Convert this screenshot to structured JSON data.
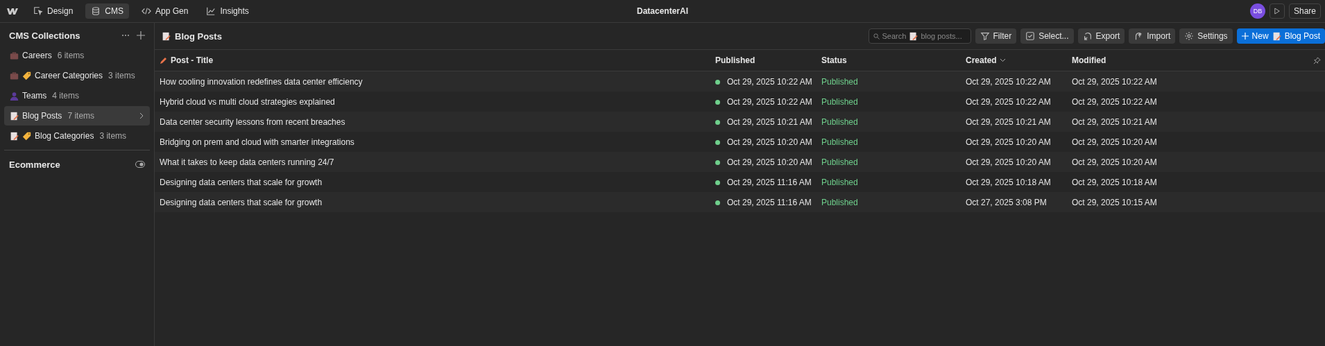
{
  "topbar": {
    "tabs": [
      {
        "label": "Design",
        "selected": false
      },
      {
        "label": "CMS",
        "selected": true
      },
      {
        "label": "App Gen",
        "selected": false
      },
      {
        "label": "Insights",
        "selected": false
      }
    ],
    "title": "DatacenterAI",
    "avatar": "DB",
    "share": "Share"
  },
  "sidebar": {
    "title": "CMS Collections",
    "items": [
      {
        "name": "Careers",
        "count": "6 items",
        "selected": false
      },
      {
        "name": "Career Categories",
        "count": "3 items",
        "selected": false
      },
      {
        "name": "Teams",
        "count": "4 items",
        "selected": false
      },
      {
        "name": "Blog Posts",
        "count": "7 items",
        "selected": true
      },
      {
        "name": "Blog Categories",
        "count": "3 items",
        "selected": false
      }
    ],
    "section": "Ecommerce"
  },
  "collection": {
    "title": "Blog Posts",
    "search": {
      "placeholder_before": "Search",
      "placeholder_after": "blog posts..."
    },
    "buttons": [
      {
        "label": "Filter"
      },
      {
        "label": "Select..."
      },
      {
        "label": "Export"
      },
      {
        "label": "Import"
      },
      {
        "label": "Settings"
      }
    ],
    "new_button": {
      "before": "New",
      "after": "Blog Post"
    }
  },
  "table": {
    "columns": [
      {
        "label": "Post - Title",
        "sorted": false
      },
      {
        "label": "Published",
        "sorted": false
      },
      {
        "label": "Status",
        "sorted": false
      },
      {
        "label": "Created",
        "sorted": true
      },
      {
        "label": "Modified",
        "sorted": false
      }
    ],
    "rows": [
      [
        "How cooling innovation redefines data center efficiency",
        "Oct 29, 2025 10:22 AM",
        "Published",
        "Oct 29, 2025 10:22 AM",
        "Oct 29, 2025 10:22 AM"
      ],
      [
        "Hybrid cloud vs multi cloud strategies explained",
        "Oct 29, 2025 10:22 AM",
        "Published",
        "Oct 29, 2025 10:22 AM",
        "Oct 29, 2025 10:22 AM"
      ],
      [
        "Data center security lessons from recent breaches",
        "Oct 29, 2025 10:21 AM",
        "Published",
        "Oct 29, 2025 10:21 AM",
        "Oct 29, 2025 10:21 AM"
      ],
      [
        "Bridging on prem and cloud with smarter integrations",
        "Oct 29, 2025 10:20 AM",
        "Published",
        "Oct 29, 2025 10:20 AM",
        "Oct 29, 2025 10:20 AM"
      ],
      [
        "What it takes to keep data centers running 24/7",
        "Oct 29, 2025 10:20 AM",
        "Published",
        "Oct 29, 2025 10:20 AM",
        "Oct 29, 2025 10:20 AM"
      ],
      [
        "Designing data centers that scale for growth",
        "Oct 29, 2025 11:16 AM",
        "Published",
        "Oct 29, 2025 10:18 AM",
        "Oct 29, 2025 10:18 AM"
      ],
      [
        "Designing data centers that scale for growth",
        "Oct 29, 2025 11:16 AM",
        "Published",
        "Oct 27, 2025 3:08 PM",
        "Oct 29, 2025 10:15 AM"
      ]
    ]
  }
}
